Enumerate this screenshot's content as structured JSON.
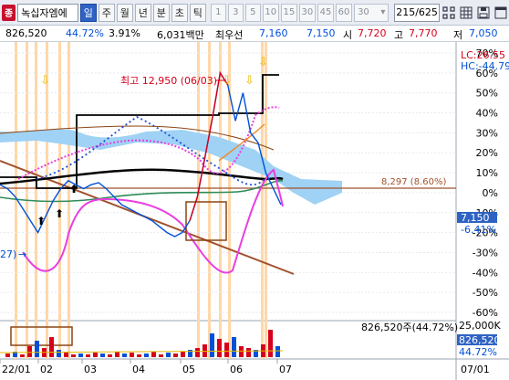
{
  "toolbar": {
    "code_badge": "종",
    "stock_name": "녹십자엠에",
    "periods": [
      {
        "label": "일",
        "active": true
      },
      {
        "label": "주",
        "active": false
      },
      {
        "label": "월",
        "active": false
      },
      {
        "label": "년",
        "active": false
      },
      {
        "label": "분",
        "active": false
      },
      {
        "label": "초",
        "active": false
      },
      {
        "label": "틱",
        "active": false
      }
    ],
    "intervals": [
      "1",
      "3",
      "5",
      "10",
      "15",
      "30",
      "45",
      "60"
    ],
    "interval_select": "30",
    "bar_count": "215/625",
    "icons": [
      "crosshair-grid-icon",
      "table-grid-icon",
      "save-icon",
      "maximize-icon"
    ]
  },
  "infobar": {
    "volume": "826,520",
    "volume_pct": "44.72%",
    "turnover": "3.91%",
    "amount": "6,031백만",
    "priority_label": "최우선",
    "bid": "7,160",
    "ask": "7,150",
    "open_label": "시",
    "open_value": "7,720",
    "high_label": "고",
    "high_value": "7,770",
    "low_label": "저",
    "low_value": "7,050"
  },
  "chart_data": {
    "type": "line",
    "price_axis_ticks": [
      "70%",
      "60%",
      "50%",
      "40%",
      "30%",
      "20%",
      "10%",
      "0%",
      "-10%",
      "-20%",
      "-30%",
      "-40%",
      "-50%",
      "-60%"
    ],
    "lc_label": "LC:26.55",
    "hc_label": "HC:-44.79",
    "high_annotation": "최고 12,950 (06/03)",
    "hline_label": "8,297 (8.60%)",
    "hline_value_pct": 8.6,
    "current_price_box": "7,150",
    "current_pct": "-6.41%",
    "low_marker_label": "27)",
    "volume_label": "826,520주(44.72%)",
    "volume_axis_max": "25,000K",
    "volume_box_value": "826,520",
    "volume_box_pct": "44.72%",
    "x_tick_labels": [
      "22/01",
      "02",
      "03",
      "04",
      "05",
      "06",
      "07"
    ],
    "x_right_label": "07/01",
    "price_pct_series": [
      4,
      2,
      -2,
      -8,
      -14,
      -20,
      -12,
      -4,
      2,
      6,
      4,
      2,
      4,
      5,
      2,
      -2,
      -6,
      -8,
      -10,
      -12,
      -14,
      -17,
      -20,
      -22,
      -20,
      -14,
      -2,
      18,
      38,
      60,
      54,
      36,
      50,
      30,
      25,
      10,
      2,
      -6
    ],
    "colors": {
      "up": "#d6001c",
      "down": "#0050d8",
      "pink": "#e83fe0",
      "purple_dot": "#a020f0",
      "trend": "#a0522d",
      "cloud": "#9fd2f5"
    }
  }
}
